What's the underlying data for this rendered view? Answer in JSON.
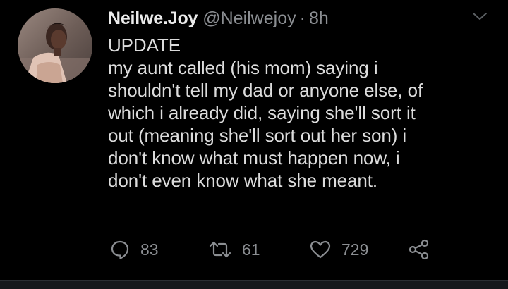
{
  "tweet": {
    "display_name": "Neilwe.Joy",
    "handle": "@Neilwejoy",
    "separator": "·",
    "time": "8h",
    "text": "UPDATE\nmy aunt called (his mom) saying i\nshouldn't tell my dad or anyone else, of\nwhich i already did, saying she'll sort it\nout (meaning she'll sort out her son) i\ndon't know what must happen now, i\ndon't even know what she meant.",
    "avatar_icon": "profile-photo",
    "menu_icon": "chevron-down-icon"
  },
  "actions": {
    "reply_count": "83",
    "retweet_count": "61",
    "like_count": "729",
    "reply_icon": "reply-icon",
    "retweet_icon": "retweet-icon",
    "like_icon": "heart-icon",
    "share_icon": "share-icon"
  },
  "colors": {
    "background": "#000000",
    "name_text": "#ebebeb",
    "body_text": "#dcdcdc",
    "muted_text": "#8b8e92",
    "bottom_bar": "#15181c"
  }
}
